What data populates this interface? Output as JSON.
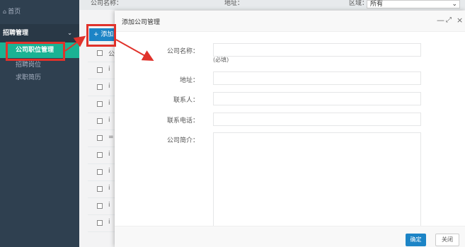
{
  "sidebar": {
    "home_label": "首页",
    "menu_title": "招聘管理",
    "items": [
      {
        "label": "公司职位管理",
        "active": true
      },
      {
        "label": "招聘岗位",
        "active": false
      },
      {
        "label": "求职简历",
        "active": false
      }
    ]
  },
  "filters": {
    "company_label": "公司名称：",
    "address_label": "地址：",
    "region_label": "区域：",
    "region_value": "所有"
  },
  "toolbar": {
    "add_label": "+ 添加"
  },
  "list": {
    "row_initials": [
      "公",
      "i",
      "i",
      "i",
      "i",
      "=",
      "i",
      "i",
      "i",
      "i",
      "i"
    ]
  },
  "dialog": {
    "title": "添加公司管理",
    "fields": {
      "company_name_label": "公司名称：",
      "company_name_hint": "(必填)",
      "address_label": "地址：",
      "contact_label": "联系人：",
      "phone_label": "联系电话：",
      "intro_label": "公司简介："
    },
    "ok_label": "确定",
    "close_label": "关闭"
  },
  "colors": {
    "sidebar_bg": "#2f4050",
    "active_item": "#1ab394",
    "primary_button": "#1c84c6",
    "annotation_red": "#e0322b"
  }
}
